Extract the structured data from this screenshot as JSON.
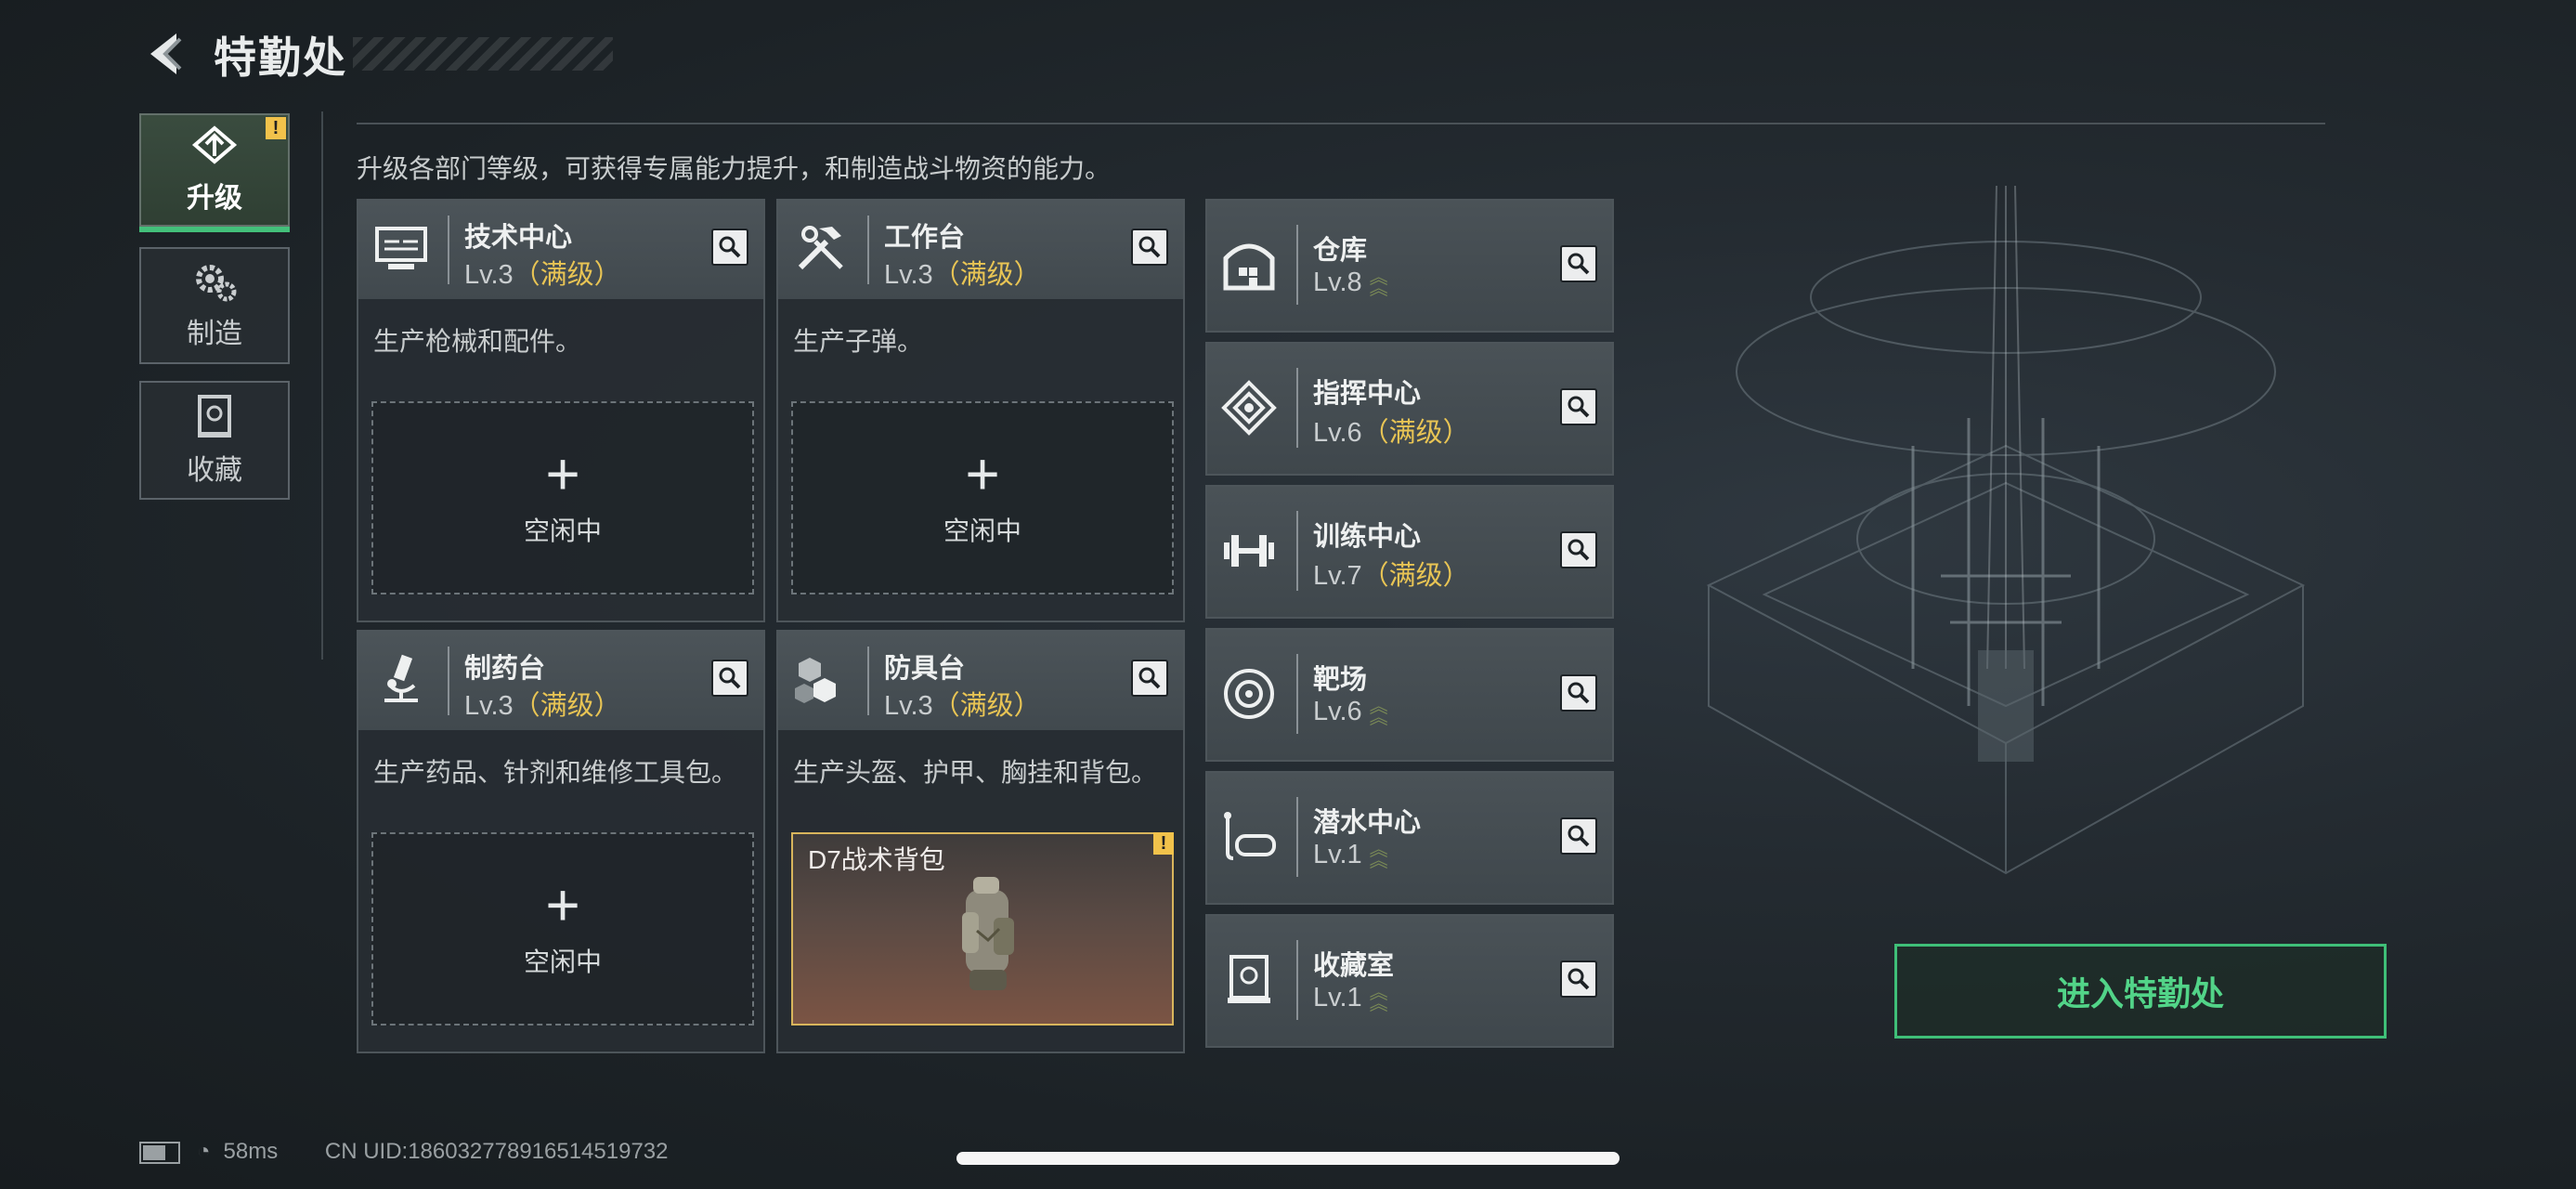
{
  "header": {
    "title": "特勤处"
  },
  "sidebar": {
    "tabs": [
      {
        "label": "升级",
        "active": true,
        "alert": "!"
      },
      {
        "label": "制造",
        "active": false
      },
      {
        "label": "收藏",
        "active": false
      }
    ]
  },
  "description": "升级各部门等级，可获得专属能力提升，和制造战斗物资的能力。",
  "departments": [
    {
      "name": "技术中心",
      "level": "Lv.3",
      "max_label": "（满级）",
      "product": "生产枪械和配件。",
      "slot": {
        "plus": "+",
        "status": "空闲中"
      }
    },
    {
      "name": "工作台",
      "level": "Lv.3",
      "max_label": "（满级）",
      "product": "生产子弹。",
      "slot": {
        "plus": "+",
        "status": "空闲中"
      }
    },
    {
      "name": "制药台",
      "level": "Lv.3",
      "max_label": "（满级）",
      "product": "生产药品、针剂和维修工具包。",
      "slot": {
        "plus": "+",
        "status": "空闲中"
      }
    },
    {
      "name": "防具台",
      "level": "Lv.3",
      "max_label": "（满级）",
      "product": "生产头盔、护甲、胸挂和背包。",
      "slot": {
        "item": "D7战术背包",
        "alert": "!"
      }
    }
  ],
  "facilities": [
    {
      "name": "仓库",
      "level": "Lv.8",
      "max_label": "",
      "upgradable": true
    },
    {
      "name": "指挥中心",
      "level": "Lv.6",
      "max_label": "（满级）",
      "upgradable": false
    },
    {
      "name": "训练中心",
      "level": "Lv.7",
      "max_label": "（满级）",
      "upgradable": false
    },
    {
      "name": "靶场",
      "level": "Lv.6",
      "max_label": "",
      "upgradable": true
    },
    {
      "name": "潜水中心",
      "level": "Lv.1",
      "max_label": "",
      "upgradable": true
    },
    {
      "name": "收藏室",
      "level": "Lv.1",
      "max_label": "",
      "upgradable": true
    }
  ],
  "enter_button": "进入特勤处",
  "status_bar": {
    "ping": "58ms",
    "uid": "CN UID:18603277891651451973​2"
  },
  "colors": {
    "accent_green": "#43c07a",
    "max_level": "#e8c454",
    "alert": "#f1c24b"
  }
}
